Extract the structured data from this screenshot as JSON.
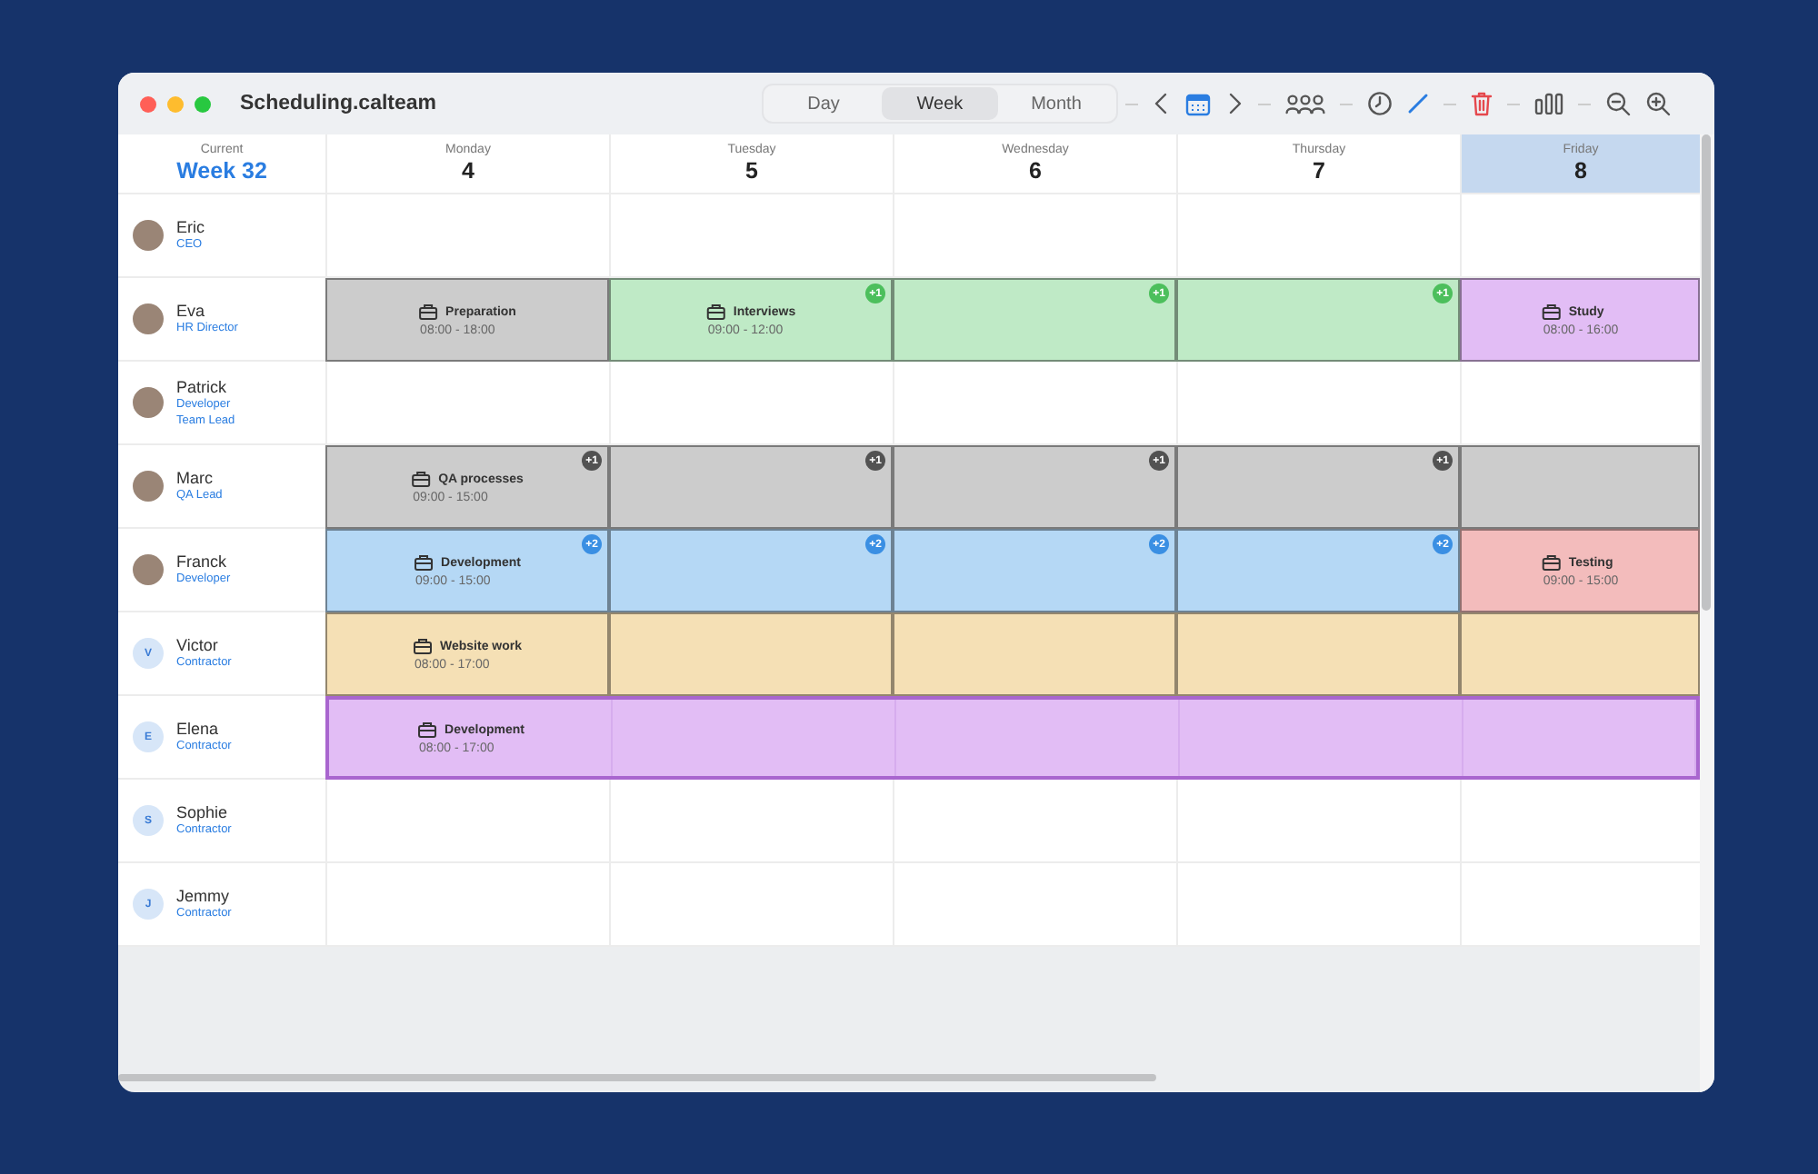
{
  "window": {
    "title": "Scheduling.calteam"
  },
  "view_tabs": [
    {
      "label": "Day",
      "selected": false
    },
    {
      "label": "Week",
      "selected": true
    },
    {
      "label": "Month",
      "selected": false
    }
  ],
  "header": {
    "caption": "Current",
    "week": "Week 32"
  },
  "days": [
    {
      "name": "Monday",
      "date": "4",
      "selected": false
    },
    {
      "name": "Tuesday",
      "date": "5",
      "selected": false
    },
    {
      "name": "Wednesday",
      "date": "6",
      "selected": false
    },
    {
      "name": "Thursday",
      "date": "7",
      "selected": false
    },
    {
      "name": "Friday",
      "date": "8",
      "selected": true
    }
  ],
  "people": [
    {
      "name": "Eric",
      "roles": [
        "CEO"
      ],
      "avatar": {
        "kind": "photo"
      },
      "cells": [
        {
          "kind": "empty"
        },
        {
          "kind": "empty"
        },
        {
          "kind": "empty"
        },
        {
          "kind": "empty"
        },
        {
          "kind": "empty"
        }
      ]
    },
    {
      "name": "Eva",
      "roles": [
        "HR Director"
      ],
      "avatar": {
        "kind": "photo"
      },
      "cells": [
        {
          "kind": "event",
          "color": "#cccccc",
          "title": "Preparation",
          "time": "08:00 - 18:00"
        },
        {
          "kind": "event",
          "color": "#bfeac6",
          "title": "Interviews",
          "time": "09:00 - 12:00",
          "badge": "+1"
        },
        {
          "kind": "continue",
          "color": "#bfeac6",
          "badge": "+1"
        },
        {
          "kind": "continue",
          "color": "#bfeac6",
          "badge": "+1"
        },
        {
          "kind": "event",
          "color": "#e2bdf5",
          "title": "Study",
          "time": "08:00 - 16:00"
        }
      ]
    },
    {
      "name": "Patrick",
      "roles": [
        "Developer",
        "Team Lead"
      ],
      "avatar": {
        "kind": "photo"
      },
      "cells": [
        {
          "kind": "empty"
        },
        {
          "kind": "empty"
        },
        {
          "kind": "empty"
        },
        {
          "kind": "empty"
        },
        {
          "kind": "empty"
        }
      ]
    },
    {
      "name": "Marc",
      "roles": [
        "QA Lead"
      ],
      "avatar": {
        "kind": "photo"
      },
      "cells": [
        {
          "kind": "event",
          "color": "#cccccc",
          "title": "QA processes",
          "time": "09:00 - 15:00",
          "badge": "+1"
        },
        {
          "kind": "continue",
          "color": "#cccccc",
          "badge": "+1"
        },
        {
          "kind": "continue",
          "color": "#cccccc",
          "badge": "+1"
        },
        {
          "kind": "continue",
          "color": "#cccccc",
          "badge": "+1"
        },
        {
          "kind": "continue",
          "color": "#cccccc"
        }
      ]
    },
    {
      "name": "Franck",
      "roles": [
        "Developer"
      ],
      "avatar": {
        "kind": "photo"
      },
      "cells": [
        {
          "kind": "event",
          "color": "#b5d8f5",
          "title": "Development",
          "time": "09:00 - 15:00",
          "badge": "+2"
        },
        {
          "kind": "continue",
          "color": "#b5d8f5",
          "badge": "+2"
        },
        {
          "kind": "continue",
          "color": "#b5d8f5",
          "badge": "+2"
        },
        {
          "kind": "continue",
          "color": "#b5d8f5",
          "badge": "+2"
        },
        {
          "kind": "event",
          "color": "#f3bcbc",
          "title": "Testing",
          "time": "09:00 - 15:00"
        }
      ]
    },
    {
      "name": "Victor",
      "roles": [
        "Contractor"
      ],
      "avatar": {
        "kind": "initial",
        "initial": "V"
      },
      "cells": [
        {
          "kind": "event",
          "color": "#f5e0b5",
          "title": "Website work",
          "time": "08:00 - 17:00"
        },
        {
          "kind": "continue",
          "color": "#f5e0b5"
        },
        {
          "kind": "continue",
          "color": "#f5e0b5"
        },
        {
          "kind": "continue",
          "color": "#f5e0b5"
        },
        {
          "kind": "continue",
          "color": "#f5e0b5"
        }
      ]
    },
    {
      "name": "Elena",
      "roles": [
        "Contractor"
      ],
      "avatar": {
        "kind": "initial",
        "initial": "E"
      },
      "block": {
        "color": "#e2bdf5",
        "title": "Development",
        "time": "08:00 - 17:00"
      }
    },
    {
      "name": "Sophie",
      "roles": [
        "Contractor"
      ],
      "avatar": {
        "kind": "initial",
        "initial": "S"
      },
      "cells": [
        {
          "kind": "empty"
        },
        {
          "kind": "empty"
        },
        {
          "kind": "empty"
        },
        {
          "kind": "empty"
        },
        {
          "kind": "empty"
        }
      ]
    },
    {
      "name": "Jemmy",
      "roles": [
        "Contractor"
      ],
      "avatar": {
        "kind": "initial",
        "initial": "J"
      },
      "cells": [
        {
          "kind": "empty"
        },
        {
          "kind": "empty"
        },
        {
          "kind": "empty"
        },
        {
          "kind": "empty"
        },
        {
          "kind": "empty"
        }
      ]
    }
  ]
}
